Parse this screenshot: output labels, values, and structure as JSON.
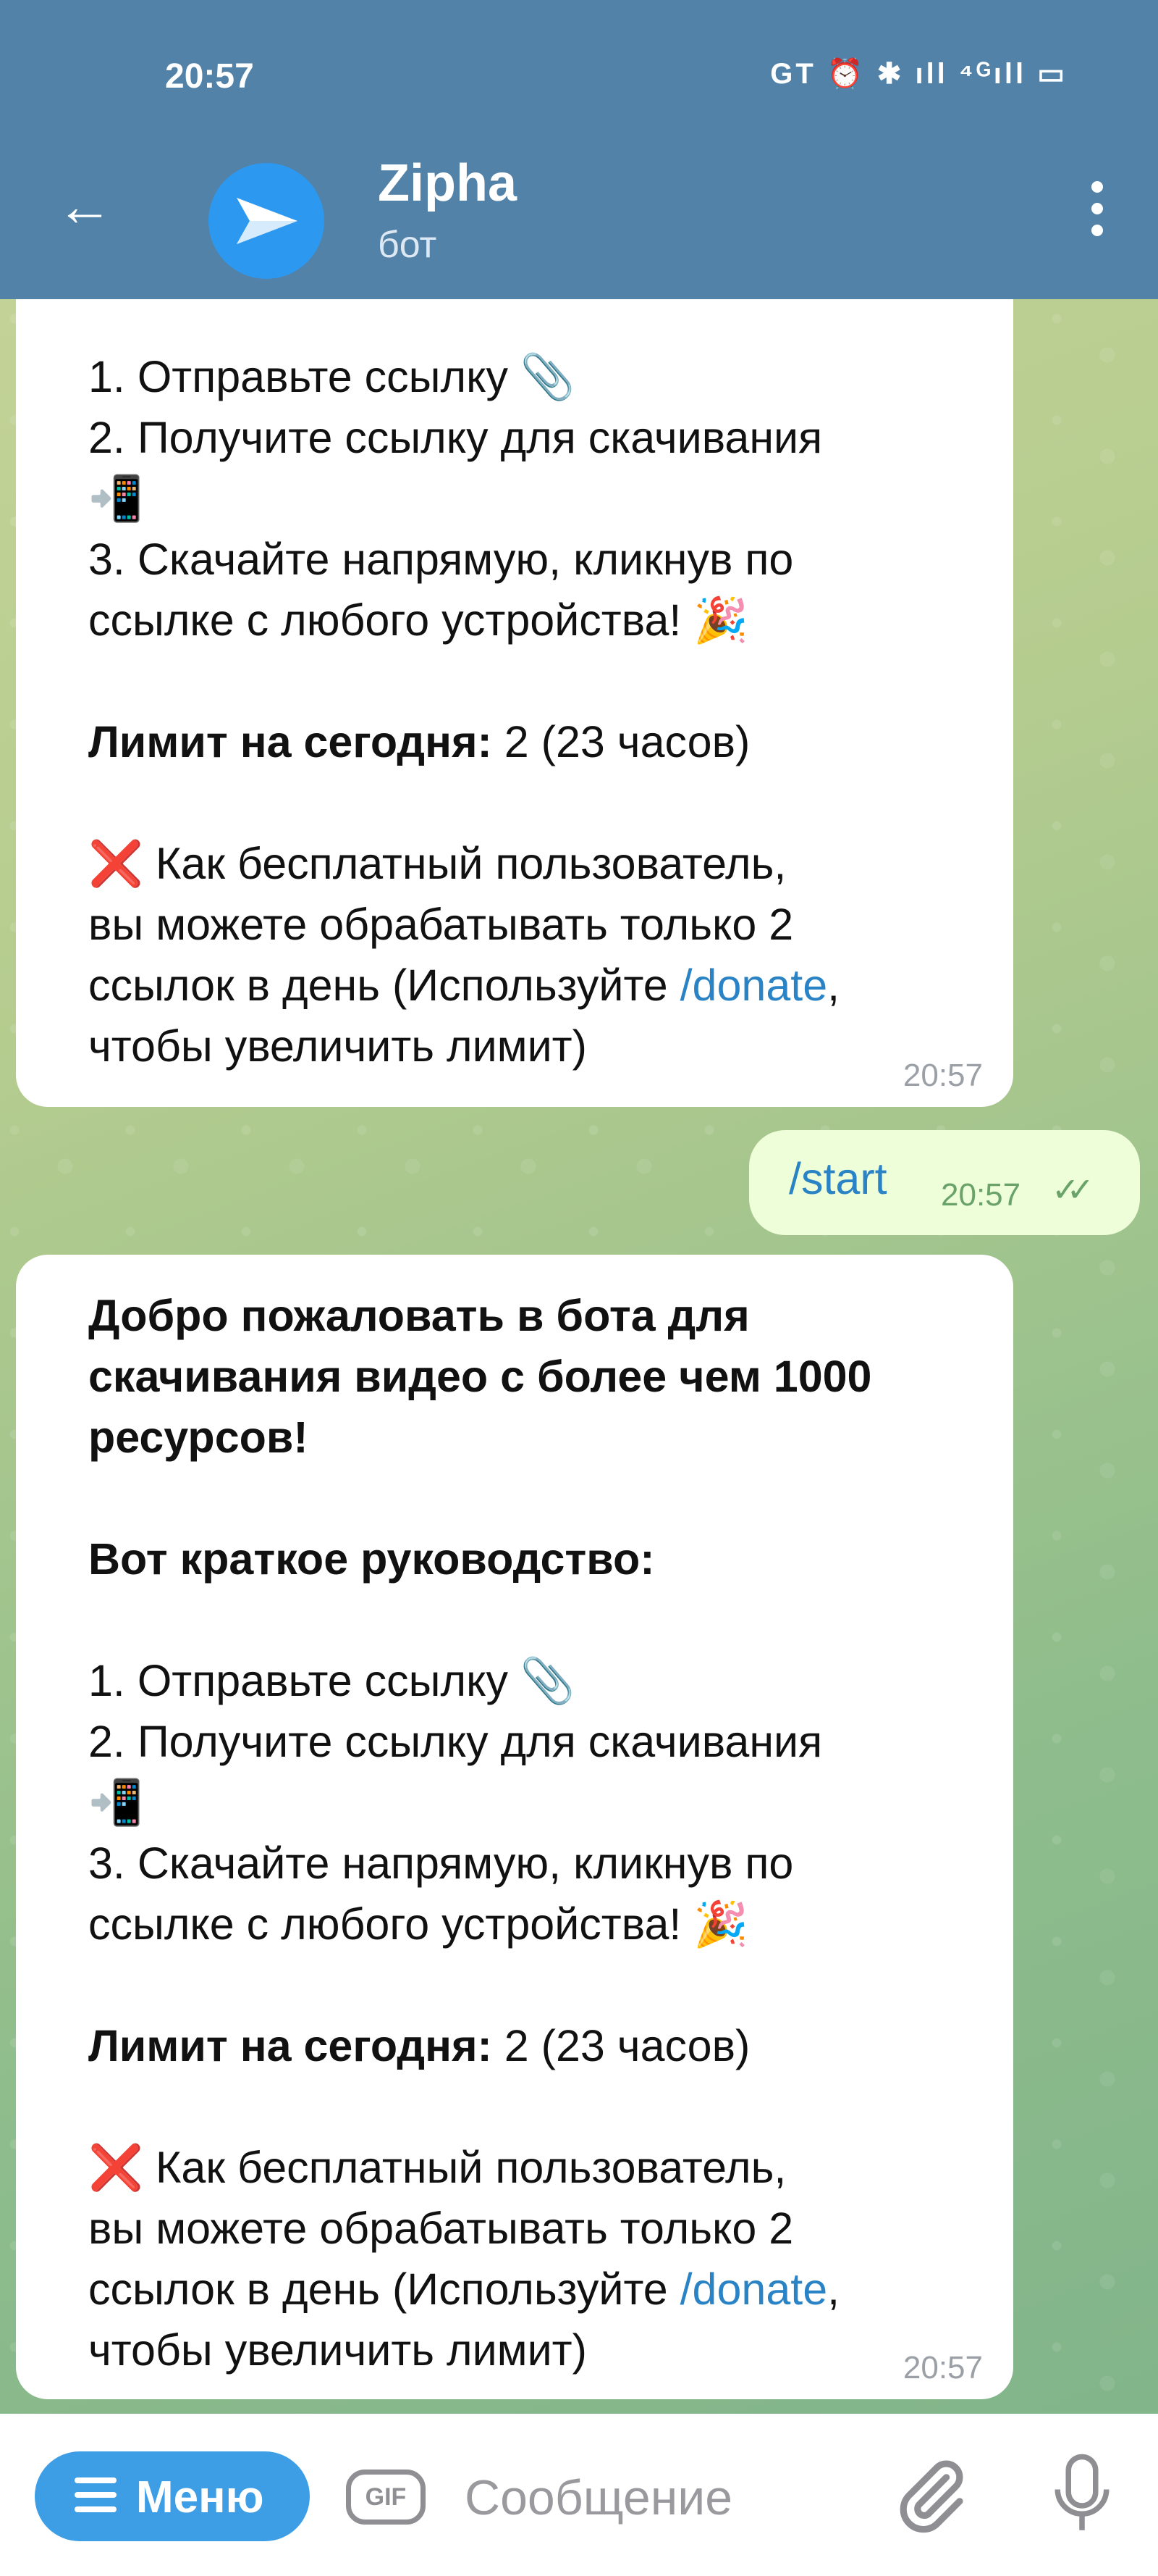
{
  "status_bar": {
    "time": "20:57",
    "icons_text": "GT ⏰ ✱ ıll ⁴ᴳıll ▭"
  },
  "header": {
    "title": "Zipha",
    "subtitle": "бот"
  },
  "messages": {
    "bubble1": {
      "line1": "1. Отправьте ссылку 📎",
      "line2": "2. Получите ссылку для скачивания",
      "line3": "📲",
      "line4": "3. Скачайте напрямую, кликнув по",
      "line5": "ссылке с любого устройства! 🎉",
      "limit_label": "Лимит на сегодня:",
      "limit_value": " 2 (23 часов)",
      "warn_icon": "❌",
      "warn1": " Как бесплатный пользователь,",
      "warn2": "вы можете обрабатывать только 2",
      "warn3_pre": "ссылок в день (Используйте ",
      "warn3_link": "/donate",
      "warn3_post": ",",
      "warn4": "чтобы увеличить лимит)",
      "time": "20:57"
    },
    "outgoing": {
      "text": "/start",
      "time": "20:57",
      "checks": "✓✓"
    },
    "bubble3": {
      "welcome1": "Добро пожаловать в бота для",
      "welcome2": "скачивания видео с более чем 1000",
      "welcome3": "ресурсов!",
      "guide": "Вот краткое руководство:",
      "line1": "1. Отправьте ссылку 📎",
      "line2": "2. Получите ссылку для скачивания",
      "line3": "📲",
      "line4": "3. Скачайте напрямую, кликнув по",
      "line5": "ссылке с любого устройства! 🎉",
      "limit_label": "Лимит на сегодня:",
      "limit_value": " 2 (23 часов)",
      "warn_icon": "❌",
      "warn1": " Как бесплатный пользователь,",
      "warn2": "вы можете обрабатывать только 2",
      "warn3_pre": "ссылок в день (Используйте ",
      "warn3_link": "/donate",
      "warn3_post": ",",
      "warn4": "чтобы увеличить лимит)",
      "time": "20:57"
    }
  },
  "input_bar": {
    "menu_label": "Меню",
    "gif_label": "GIF",
    "placeholder": "Сообщение"
  },
  "colors": {
    "header": "#5282a8",
    "accent": "#3d9ee6",
    "link": "#2a83c5",
    "outgoing_bubble": "#eefed8"
  }
}
